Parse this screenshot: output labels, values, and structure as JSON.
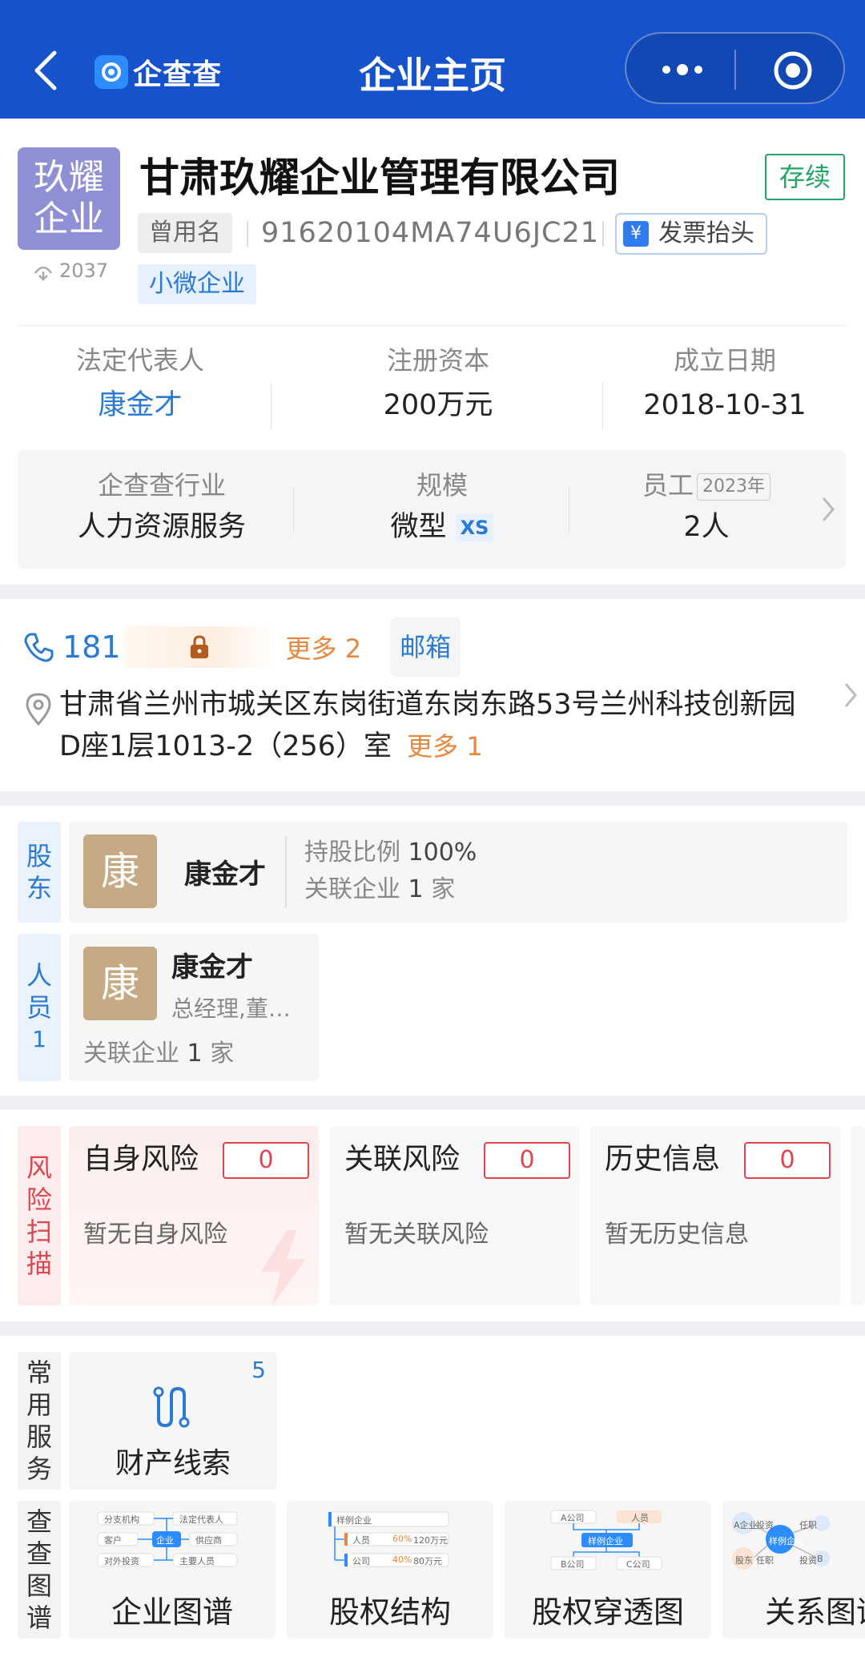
{
  "header": {
    "logo_text": "企查查",
    "title": "企业主页"
  },
  "company": {
    "avatar_text": "玖耀企业",
    "views": "2037",
    "name": "甘肃玖耀企业管理有限公司",
    "status": "存续",
    "former_name_tag": "曾用名",
    "credit_code": "91620104MA74U6JC21",
    "invoice_label": "发票抬头",
    "size_tag": "小微企业"
  },
  "basic": {
    "legal_rep_label": "法定代表人",
    "legal_rep": "康金才",
    "capital_label": "注册资本",
    "capital": "200万元",
    "founded_label": "成立日期",
    "founded": "2018-10-31",
    "industry_label": "企查查行业",
    "industry": "人力资源服务",
    "scale_label": "规模",
    "scale": "微型",
    "scale_badge": "XS",
    "staff_label": "员工",
    "staff_year": "2023年",
    "staff": "2人"
  },
  "contact": {
    "phone": "181",
    "phone_more": "更多 2",
    "email_label": "邮箱",
    "address": "甘肃省兰州市城关区东岗街道东岗东路53号兰州科技创新园D座1层1013-2（256）室",
    "address_more": "更多 1"
  },
  "shareholder": {
    "label": "股东",
    "avatar": "康",
    "name": "康金才",
    "ratio_label": "持股比例",
    "ratio": "100%",
    "related_label": "关联企业",
    "related_count": "1",
    "related_unit": "家"
  },
  "staff_section": {
    "label": "人员",
    "count": "1",
    "avatar": "康",
    "name": "康金才",
    "role": "总经理,董…",
    "related_label": "关联企业",
    "related_count": "1",
    "related_unit": "家"
  },
  "risk": {
    "label": "风险扫描",
    "cards": [
      {
        "title": "自身风险",
        "count": "0",
        "desc": "暂无自身风险"
      },
      {
        "title": "关联风险",
        "count": "0",
        "desc": "暂无关联风险"
      },
      {
        "title": "历史信息",
        "count": "0",
        "desc": "暂无历史信息"
      }
    ]
  },
  "services": {
    "label": "常用服务",
    "item_title": "财产线索",
    "item_badge": "5"
  },
  "graphs": {
    "label": "查查图谱",
    "cards": [
      {
        "title": "企业图谱",
        "mini": [
          "分支机构",
          "法定代表人",
          "客户",
          "企业",
          "供应商",
          "对外投资",
          "主要人员"
        ]
      },
      {
        "title": "股权结构",
        "mini": [
          "样例企业",
          "人员",
          "60%",
          "120万元",
          "公司",
          "40%",
          "80万元"
        ]
      },
      {
        "title": "股权穿透图",
        "mini": [
          "A公司",
          "人员",
          "样例企业",
          "B公司",
          "C公司"
        ]
      },
      {
        "title": "关系图谱",
        "mini": [
          "A企业",
          "投资",
          "任职",
          "样例企业",
          "股东",
          "任职",
          "投资",
          "B"
        ]
      }
    ]
  },
  "colors": {
    "header_bg": "#1552cc",
    "link_blue": "#2a7ad4",
    "status_green": "#23a565",
    "risk_red": "#e0454e",
    "more_orange": "#e7873d"
  }
}
